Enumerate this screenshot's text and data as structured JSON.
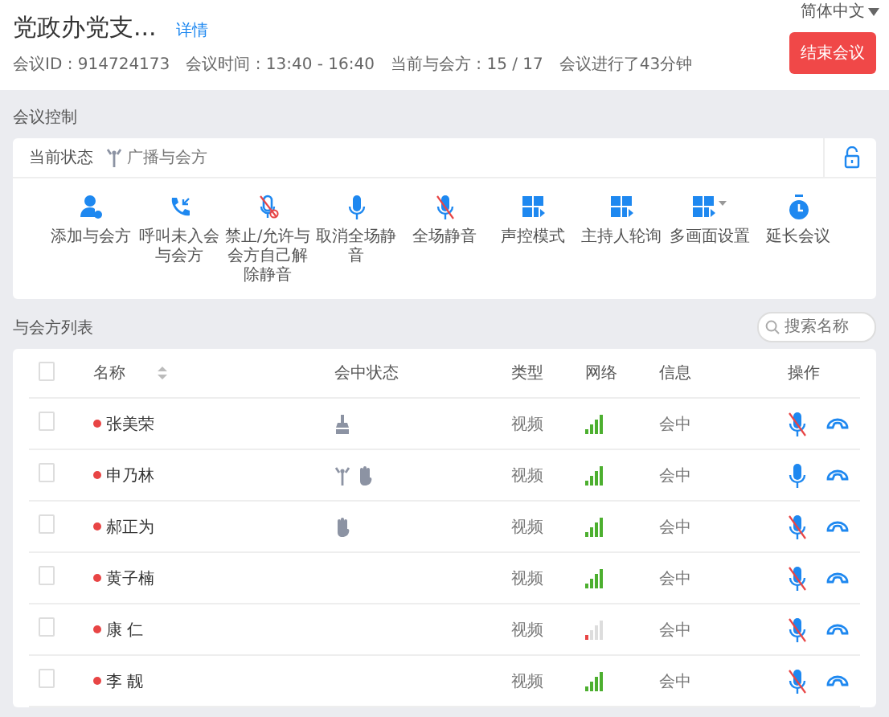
{
  "header": {
    "language": "简体中文",
    "title": "党政办党支...",
    "details_link": "详情",
    "meta": [
      "会议ID : 914724173",
      "会议时间 : 13:40 - 16:40",
      "当前与会方 : 15 / 17",
      "会议进行了43分钟"
    ],
    "end_button": "结束会议"
  },
  "control": {
    "heading": "会议控制",
    "status_label": "当前状态",
    "status_value": "广播与会方",
    "locked": false,
    "actions": [
      {
        "kind": "person",
        "label": "添加与会方"
      },
      {
        "kind": "call",
        "label": "呼叫未入会与会方"
      },
      {
        "kind": "micban",
        "label": "禁止/允许与会方自己解除静音"
      },
      {
        "kind": "mic",
        "label": "取消全场静音"
      },
      {
        "kind": "micoff",
        "label": "全场静音"
      },
      {
        "kind": "grid",
        "label": "声控模式"
      },
      {
        "kind": "grid",
        "label": "主持人轮询"
      },
      {
        "kind": "griddrop",
        "label": "多画面设置"
      },
      {
        "kind": "timer",
        "label": "延长会议"
      }
    ]
  },
  "participants": {
    "heading": "与会方列表",
    "search": {
      "placeholder": "搜索名称"
    },
    "columns": [
      "名称",
      "会中状态",
      "类型",
      "网络",
      "信息",
      "操作"
    ],
    "header_checked": false,
    "rows": [
      {
        "checked": false,
        "color": "#e84545",
        "name": "张美荣",
        "status": [
          {
            "kind": "host"
          }
        ],
        "type": "视频",
        "weak_signal": false,
        "info": "会中",
        "muted": true
      },
      {
        "checked": false,
        "color": "#e84545",
        "name": "申乃林",
        "status": [
          {
            "kind": "broadcast"
          },
          {
            "kind": "hand"
          }
        ],
        "type": "视频",
        "weak_signal": false,
        "info": "会中",
        "muted": false
      },
      {
        "checked": false,
        "color": "#e84545",
        "name": "郝正为",
        "status": [
          {
            "kind": "hand"
          }
        ],
        "type": "视频",
        "weak_signal": false,
        "info": "会中",
        "muted": true
      },
      {
        "checked": false,
        "color": "#e84545",
        "name": "黄子楠",
        "type": "视频",
        "weak_signal": false,
        "info": "会中",
        "muted": true
      },
      {
        "checked": false,
        "color": "#e84545",
        "name": "康 仁",
        "type": "视频",
        "weak_signal": true,
        "info": "会中",
        "muted": true
      },
      {
        "checked": false,
        "color": "#e84545",
        "name": "李 靓",
        "type": "视频",
        "weak_signal": false,
        "info": "会中",
        "muted": true
      }
    ]
  }
}
